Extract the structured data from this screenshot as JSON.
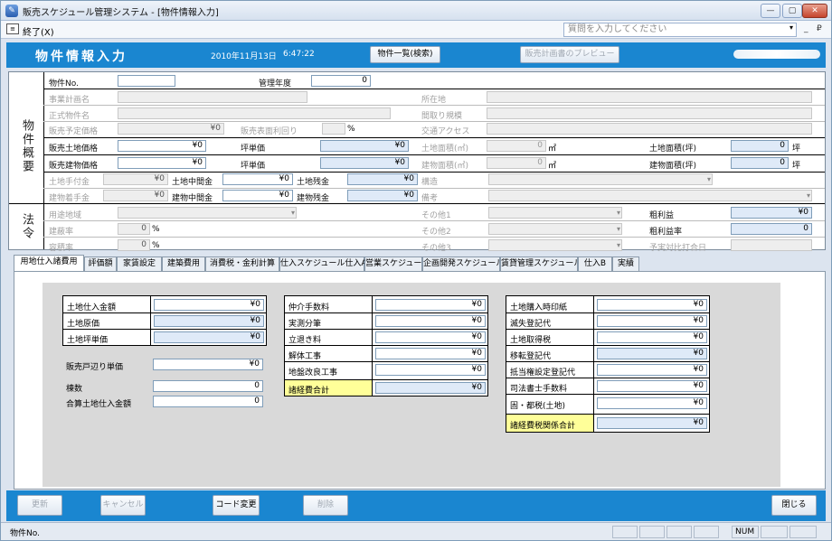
{
  "window": {
    "title": "販売スケジュール管理システム - [物件情報入力]",
    "minimize": "—",
    "maximize": "▢",
    "close": "✕"
  },
  "menu": {
    "exit": "終了(X)",
    "help_placeholder": "質問を入力してください",
    "mdi_min": "_",
    "mdi_restore": "₽"
  },
  "header": {
    "title": "物件情報入力",
    "date": "2010年11月13日",
    "time": "6:47:22",
    "list_button": "物件一覧(検索)",
    "preview_button": "販売計画書のプレビュー"
  },
  "overview": {
    "section_label": "物件概要",
    "property_no_label": "物件No.",
    "mgmt_year_label": "管理年度",
    "mgmt_year_value": "0",
    "project_plan_name": "事業計画名",
    "location": "所在地",
    "official_name": "正式物件名",
    "floor_plan": "間取り規模",
    "planned_price_label": "販売予定価格",
    "planned_price_value": "¥0",
    "surface_yield_label": "販売表面利回り",
    "surface_yield_unit": "%",
    "transport": "交通アクセス",
    "land_price_label": "販売土地価格",
    "land_price_value": "¥0",
    "tsubo_price_label": "坪単価",
    "tsubo_price_value": "¥0",
    "land_area_label": "土地面積(㎡)",
    "land_area_value": "0",
    "land_area_unit": "㎡",
    "land_area_tsubo_label": "土地面積(坪)",
    "land_area_tsubo_value": "0",
    "tsubo_unit": "坪",
    "building_price_label": "販売建物価格",
    "building_price_value": "¥0",
    "tsubo_price2_label": "坪単価",
    "tsubo_price2_value": "¥0",
    "building_area_label": "建物面積(㎡)",
    "building_area_value": "0",
    "building_area_unit": "㎡",
    "building_area_tsubo_label": "建物面積(坪)",
    "building_area_tsubo_value": "0",
    "building_tsubo_unit": "坪",
    "land_deposit_label": "土地手付金",
    "land_deposit_value": "¥0",
    "land_interim_label": "土地中間金",
    "land_interim_value": "¥0",
    "land_balance_label": "土地残金",
    "land_balance_value": "¥0",
    "structure": "構造",
    "building_start_label": "建物着手金",
    "building_start_value": "¥0",
    "building_interim_label": "建物中間金",
    "building_interim_value": "¥0",
    "building_balance_label": "建物残金",
    "building_balance_value": "¥0",
    "remarks": "備考"
  },
  "law": {
    "section_label": "法令",
    "zoning": "用途地域",
    "other1": "その他1",
    "gross_profit_label": "粗利益",
    "gross_profit_value": "¥0",
    "coverage_label": "建蔽率",
    "coverage_value": "0",
    "coverage_unit": "%",
    "other2": "その他2",
    "gross_margin_label": "粗利益率",
    "gross_margin_value": "0",
    "far_label": "容積率",
    "far_value": "0",
    "far_unit": "%",
    "other3": "その他3",
    "budget_meeting": "予実対比打合日"
  },
  "tabs": [
    "用地仕入諸費用",
    "評価額",
    "家賃設定",
    "建築費用",
    "消費税・金利計算",
    "仕入スケジュール仕入A",
    "営業スケジュール",
    "企画開発スケジュール",
    "賃貸管理スケジュール",
    "仕入B",
    "実績"
  ],
  "group1": {
    "items": [
      {
        "label": "土地仕入金額",
        "value": "¥0"
      },
      {
        "label": "土地原価",
        "value": "¥0"
      },
      {
        "label": "土地坪単価",
        "value": "¥0"
      }
    ]
  },
  "extra": {
    "sales_unit_price_label": "販売戸辺り単価",
    "sales_unit_price_value": "¥0",
    "count_label": "棟数",
    "count_value": "0",
    "total_land_label": "合算土地仕入金額",
    "total_land_value": "0"
  },
  "group2": {
    "items": [
      {
        "label": "仲介手数料",
        "value": "¥0"
      },
      {
        "label": "実測分筆",
        "value": "¥0"
      },
      {
        "label": "立退き料",
        "value": "¥0"
      },
      {
        "label": "解体工事",
        "value": "¥0"
      },
      {
        "label": "地盤改良工事",
        "value": "¥0"
      }
    ],
    "total_label": "諸経費合計",
    "total_value": "¥0"
  },
  "group3": {
    "items": [
      {
        "label": "土地購入時印紙",
        "value": "¥0"
      },
      {
        "label": "滅失登記代",
        "value": "¥0"
      },
      {
        "label": "土地取得税",
        "value": "¥0"
      },
      {
        "label": "移転登記代",
        "value": "¥0"
      },
      {
        "label": "抵当権設定登記代",
        "value": "¥0"
      },
      {
        "label": "司法書士手数料",
        "value": "¥0"
      },
      {
        "label": "固・都税(土地)",
        "value": "¥0"
      }
    ],
    "total_label": "諸経費税関係合計",
    "total_value": "¥0"
  },
  "footer": {
    "update": "更新",
    "cancel": "キャンセル",
    "code_change": "コード変更",
    "delete": "削除",
    "close": "閉じる"
  },
  "status": {
    "text": "物件No.",
    "num": "NUM"
  }
}
